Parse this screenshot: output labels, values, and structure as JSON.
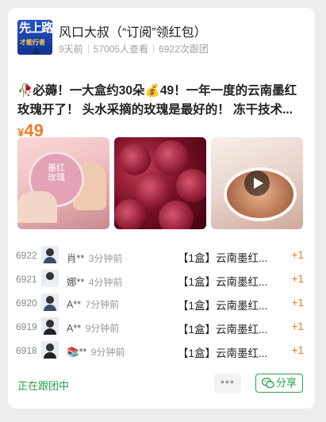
{
  "header": {
    "avatar_text_top": "先上路",
    "avatar_text_bottom": "才能行者",
    "title": "风口大叔（“订阅”领红包）",
    "time": "9天前",
    "views": "57005人查看",
    "joins": "6922次跟团"
  },
  "post": {
    "line1": "🥀必薅！一大盒约30朵💰49！一年一度的云南墨红",
    "line2": "玫瑰开了！ 头水采摘的玫瑰是最好的！ 冻干技术...",
    "price_symbol": "¥",
    "price": "49",
    "image1_text": "墨红玫瑰"
  },
  "orders": [
    {
      "no": "6922",
      "name": "肖**",
      "ago": "3分钟前",
      "item": "【1盒】云南墨红...",
      "qty": "+1"
    },
    {
      "no": "6921",
      "name": "娜**",
      "ago": "4分钟前",
      "item": "【1盒】云南墨红...",
      "qty": "+1"
    },
    {
      "no": "6920",
      "name": "A**",
      "ago": "7分钟前",
      "item": "【1盒】云南墨红...",
      "qty": "+1"
    },
    {
      "no": "6919",
      "name": "A**",
      "ago": "9分钟前",
      "item": "【1盒】云南墨红...",
      "qty": "+1"
    },
    {
      "no": "6918",
      "name": "📚**",
      "ago": "9分钟前",
      "item": "【1盒】云南墨红...",
      "qty": "+1"
    }
  ],
  "footer": {
    "status": "正在跟团中",
    "more": "•••",
    "share": "分享"
  },
  "colors": {
    "accent_green": "#2aa34a",
    "price_orange": "#f07a2a"
  },
  "icons": [
    "more-icon",
    "wechat-icon",
    "play-icon"
  ]
}
